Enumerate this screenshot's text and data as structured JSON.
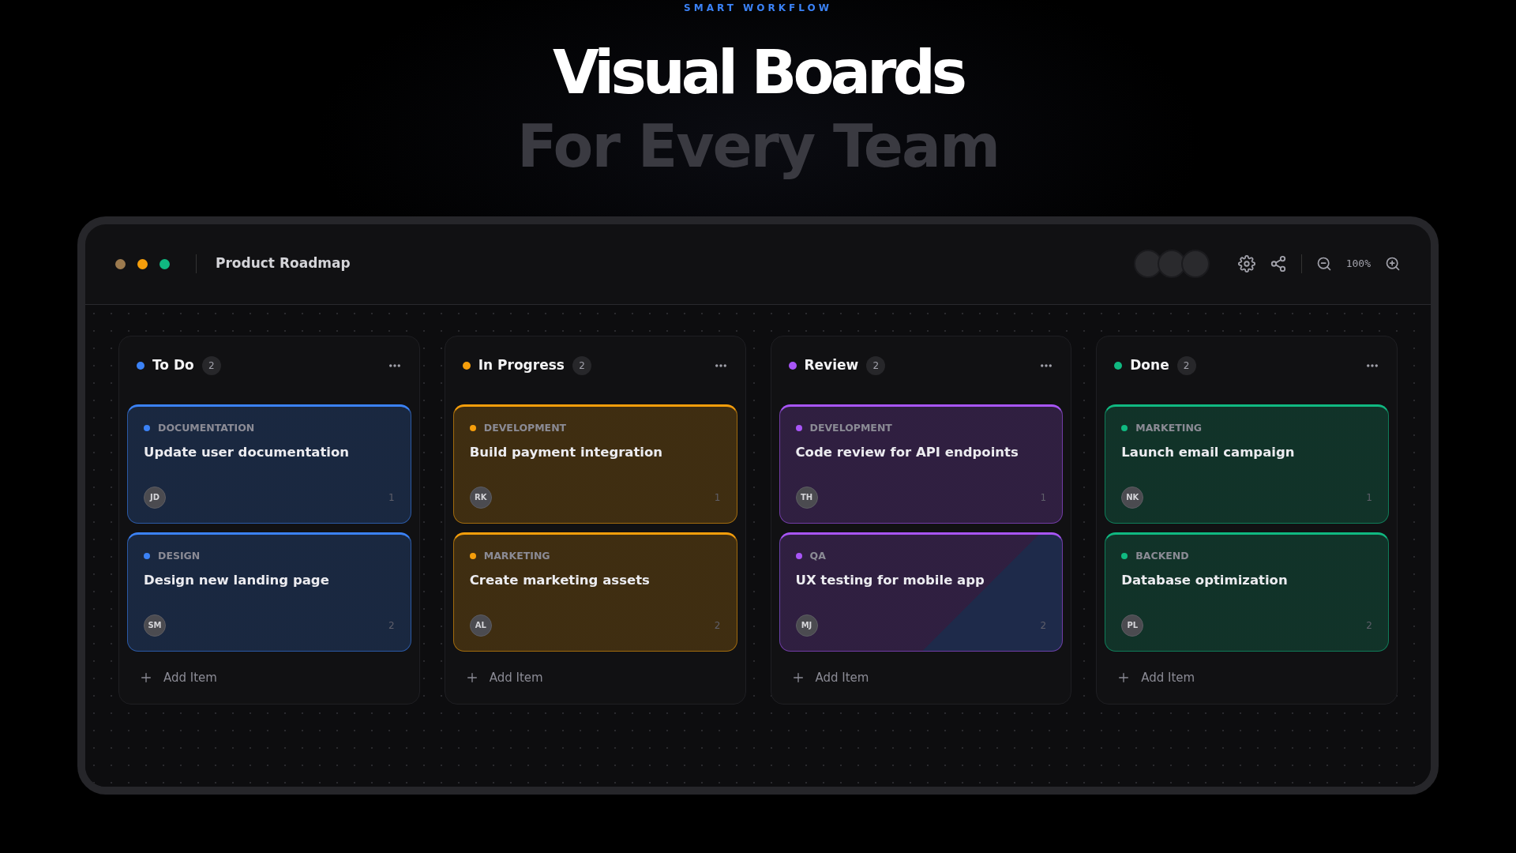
{
  "eyebrow": "SMART WORKFLOW",
  "headline": {
    "line1": "Visual Boards",
    "line2": "For Every Team"
  },
  "window": {
    "title": "Product Roadmap",
    "dots": [
      {
        "color": "#9c7a4e"
      },
      {
        "color": "#f59e0b"
      },
      {
        "color": "#10b981"
      }
    ],
    "zoom": "100%"
  },
  "columns": [
    {
      "title": "To Do",
      "count": "2",
      "color": "#3b82f6",
      "cards": [
        {
          "tag": "DOCUMENTATION",
          "title": "Update user documentation",
          "avatar": "JD",
          "number": "1",
          "shaded": false
        },
        {
          "tag": "DESIGN",
          "title": "Design new landing page",
          "avatar": "SM",
          "number": "2",
          "shaded": false
        }
      ],
      "add_label": "Add Item"
    },
    {
      "title": "In Progress",
      "count": "2",
      "color": "#f59e0b",
      "cards": [
        {
          "tag": "DEVELOPMENT",
          "title": "Build payment integration",
          "avatar": "RK",
          "number": "1",
          "shaded": false
        },
        {
          "tag": "MARKETING",
          "title": "Create marketing assets",
          "avatar": "AL",
          "number": "2",
          "shaded": false
        }
      ],
      "add_label": "Add Item"
    },
    {
      "title": "Review",
      "count": "2",
      "color": "#a855f7",
      "cards": [
        {
          "tag": "DEVELOPMENT",
          "title": "Code review for API endpoints",
          "avatar": "TH",
          "number": "1",
          "shaded": false
        },
        {
          "tag": "QA",
          "title": "UX testing for mobile app",
          "avatar": "MJ",
          "number": "2",
          "shaded": true
        }
      ],
      "add_label": "Add Item"
    },
    {
      "title": "Done",
      "count": "2",
      "color": "#10b981",
      "cards": [
        {
          "tag": "MARKETING",
          "title": "Launch email campaign",
          "avatar": "NK",
          "number": "1",
          "shaded": false
        },
        {
          "tag": "BACKEND",
          "title": "Database optimization",
          "avatar": "PL",
          "number": "2",
          "shaded": false
        }
      ],
      "add_label": "Add Item"
    }
  ]
}
